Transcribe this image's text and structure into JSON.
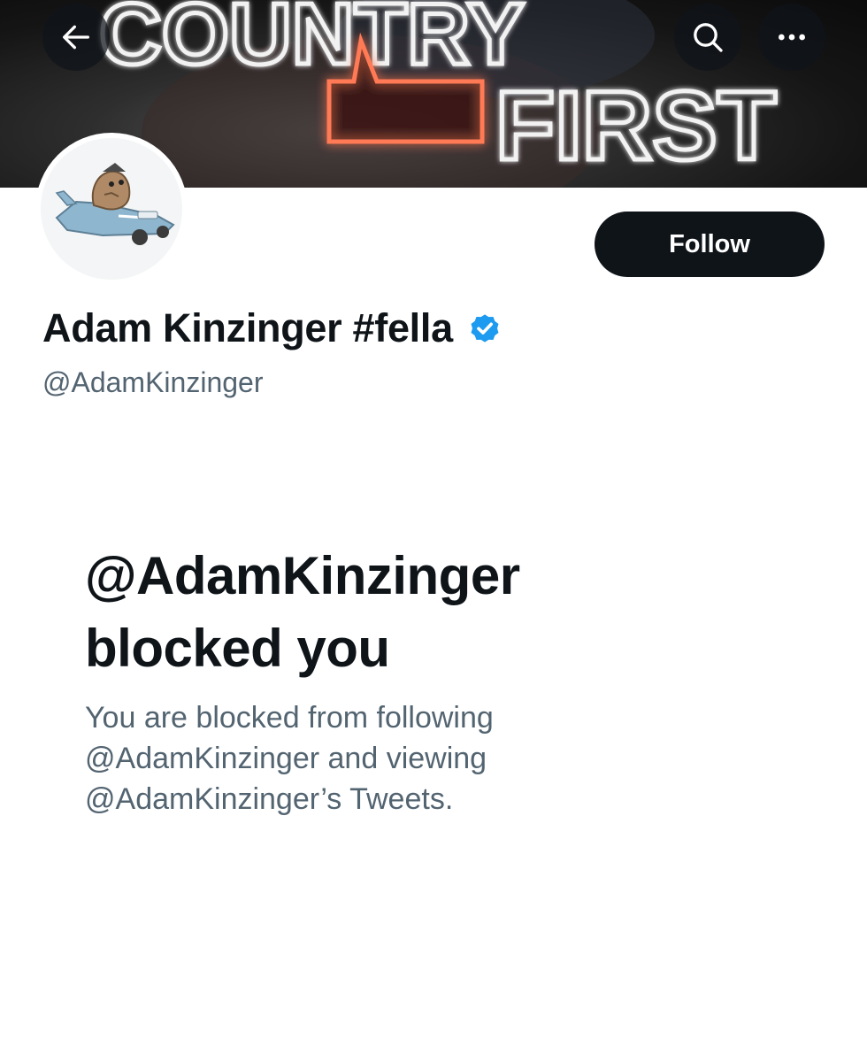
{
  "header": {
    "banner_text_line1": "COUNTRY",
    "banner_text_line2": "FIRST",
    "back_icon": "arrow-left-icon",
    "search_icon": "search-icon",
    "more_icon": "more-horizontal-icon"
  },
  "profile": {
    "display_name": "Adam Kinzinger #fella",
    "handle": "@AdamKinzinger",
    "verified": true,
    "follow_label": "Follow"
  },
  "blocked": {
    "title_line1": "@AdamKinzinger",
    "title_line2": "blocked you",
    "desc_line1": "You are blocked from following",
    "desc_line2": "@AdamKinzinger and viewing",
    "desc_line3": "@AdamKinzinger’s Tweets."
  },
  "colors": {
    "text_primary": "#0f1419",
    "text_secondary": "#536471",
    "verified_blue": "#1d9bf0",
    "button_bg": "#0f1419"
  }
}
